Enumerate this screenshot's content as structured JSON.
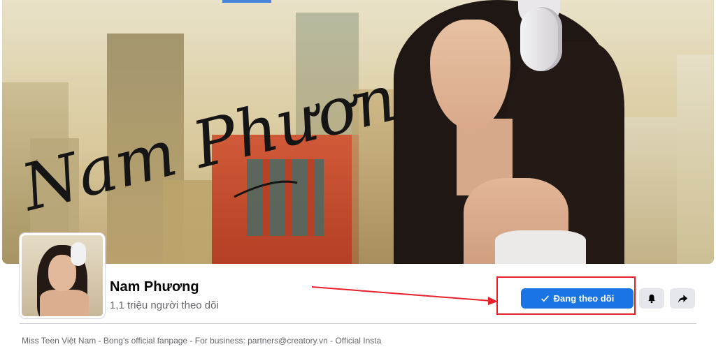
{
  "cover": {
    "signature_text": "Nam Phương"
  },
  "profile": {
    "name": "Nam Phương",
    "followers": "1,1 triệu người theo dõi"
  },
  "actions": {
    "follow_label": "Đang theo dõi",
    "bell_icon": "bell-icon",
    "share_icon": "share-icon"
  },
  "about": {
    "text": "Miss Teen Việt Nam - Bong's official fanpage - For business: partners@creatory.vn - Official Insta"
  },
  "colors": {
    "primary_button": "#1b74e4",
    "highlight": "#e8202a",
    "secondary_button": "#e4e6eb"
  }
}
